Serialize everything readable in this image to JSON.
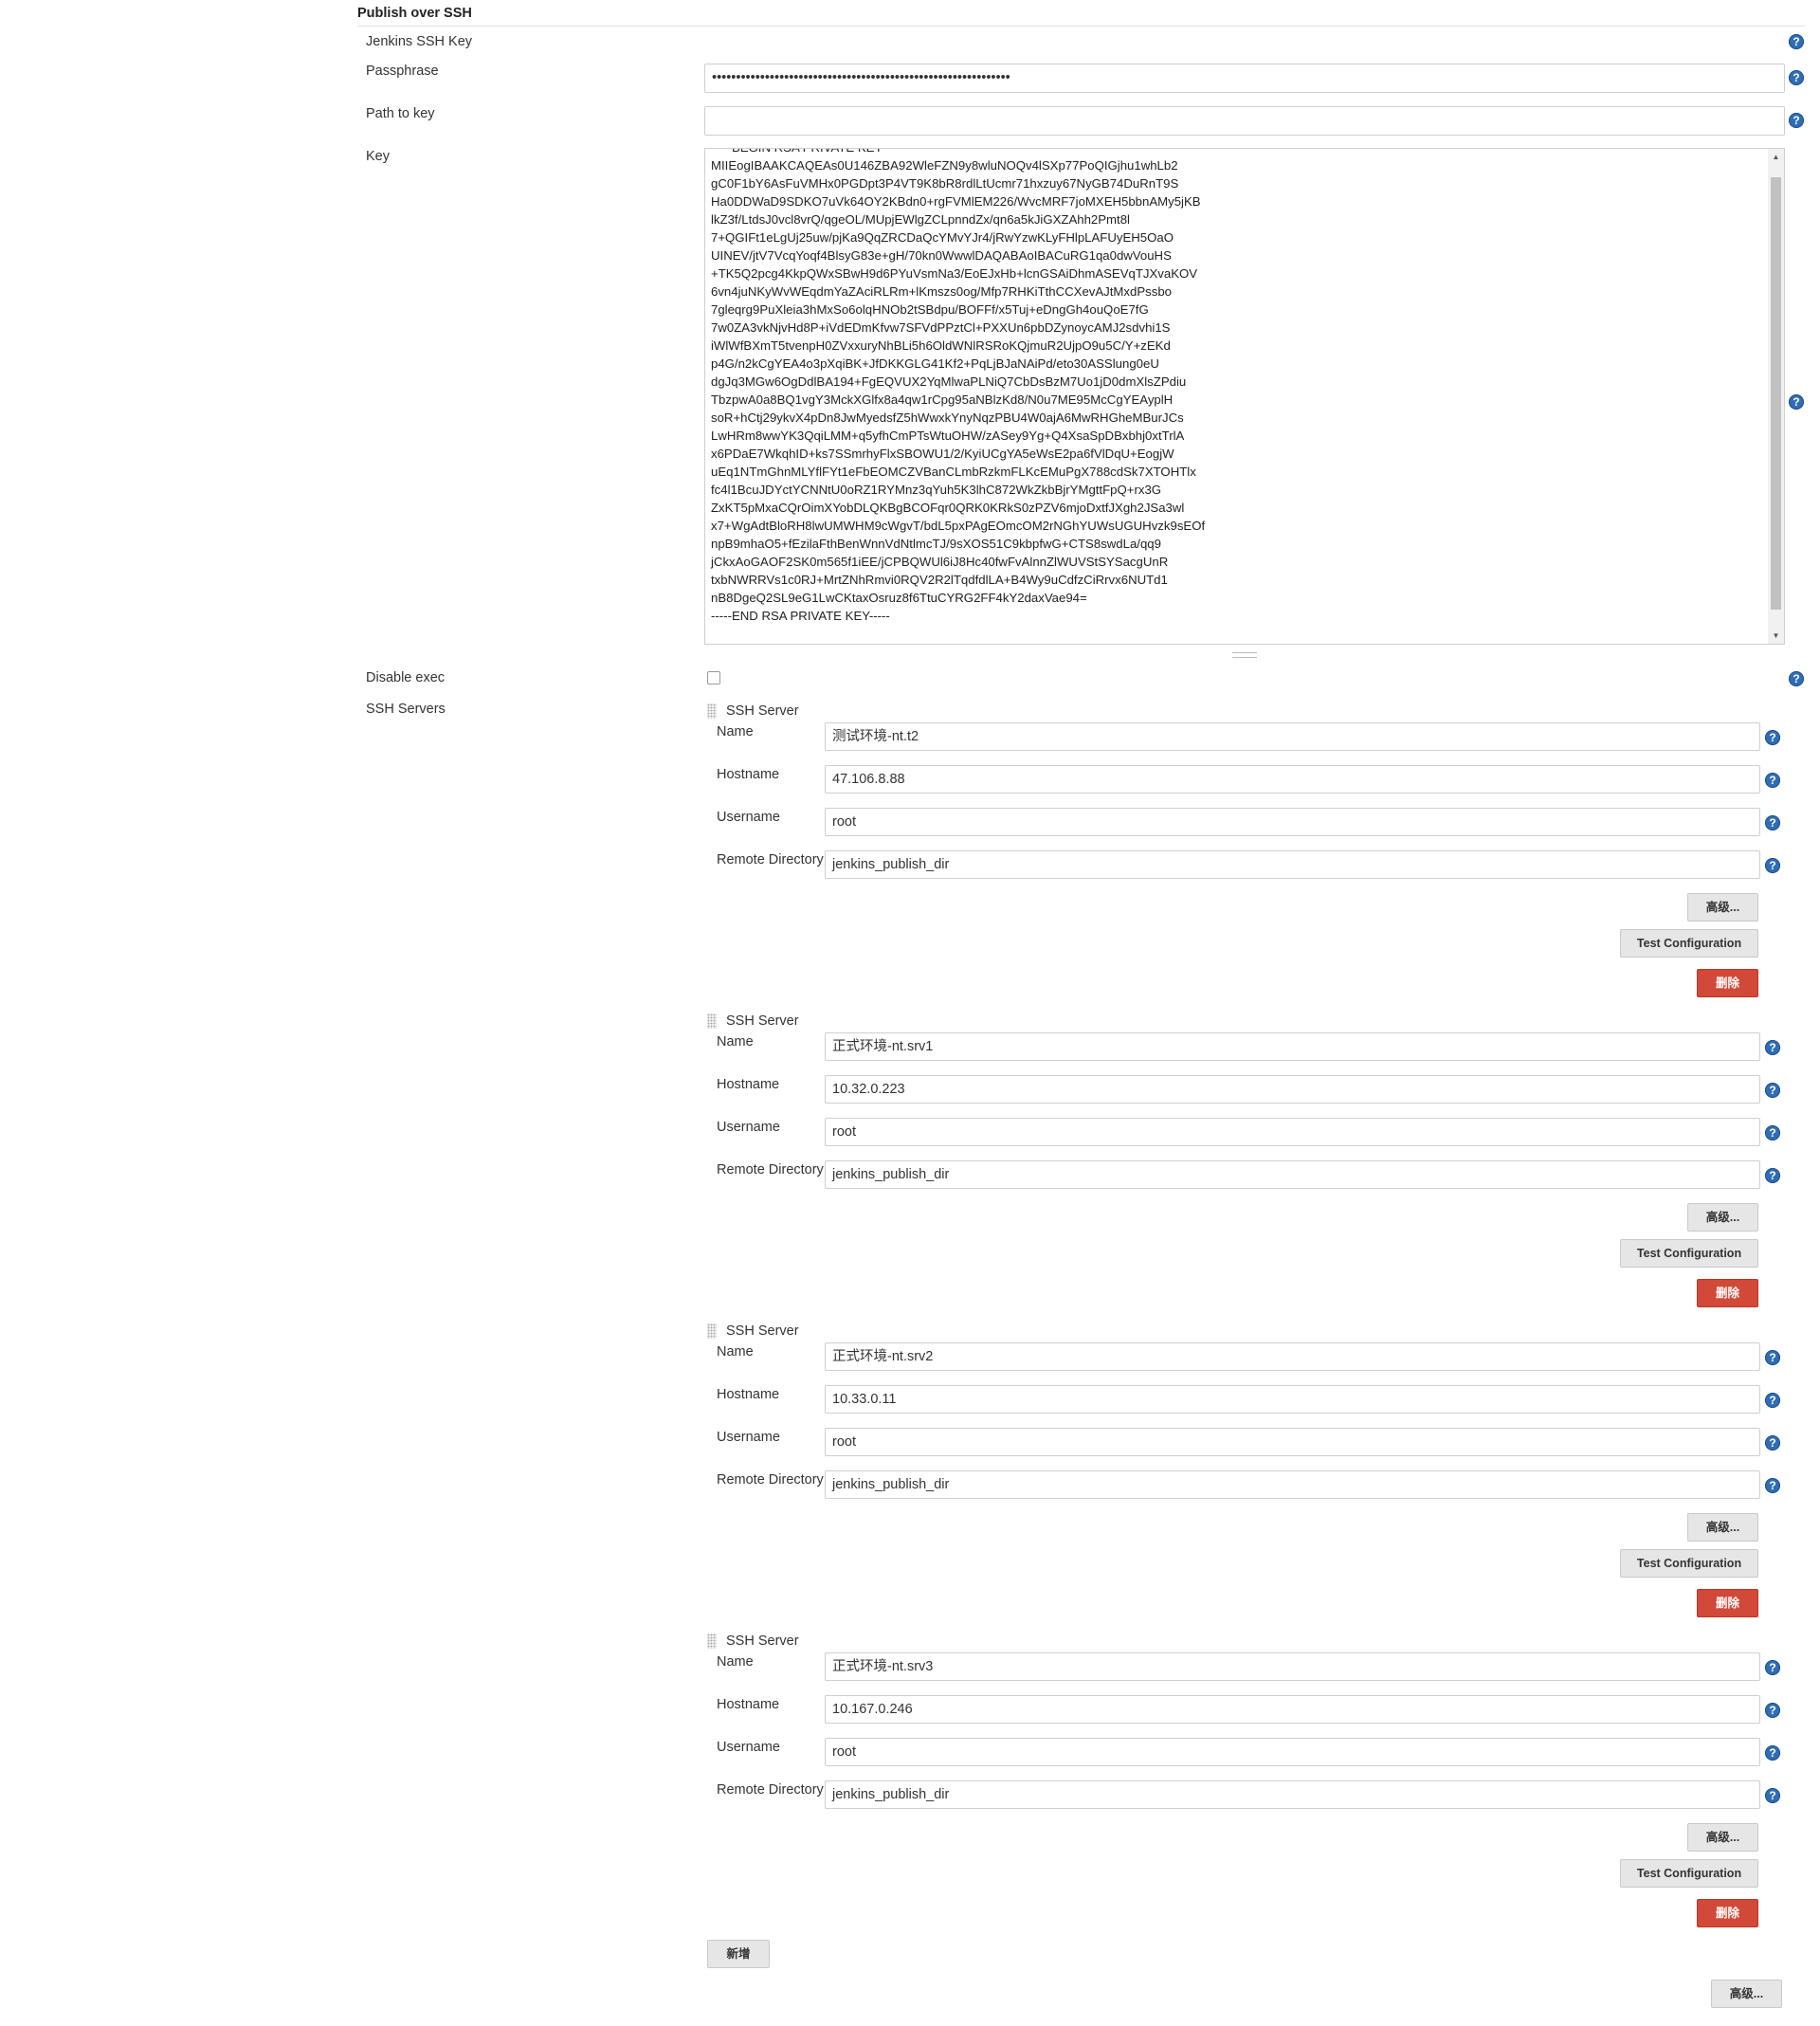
{
  "section_title": "Publish over SSH",
  "fields": {
    "jenkins_ssh_key_label": "Jenkins SSH Key",
    "passphrase_label": "Passphrase",
    "passphrase_value": "••••••••••••••••••••••••••••••••••••••••••••••••••••••••••••••",
    "path_to_key_label": "Path to key",
    "path_to_key_value": "",
    "key_label": "Key",
    "key_value": "-----BEGIN RSA PRIVATE KEY-----\nMIIEogIBAAKCAQEAs0U146ZBA92WleFZN9y8wluNOQv4lSXp77PoQIGjhu1whLb2\ngC0F1bY6AsFuVMHx0PGDpt3P4VT9K8bR8rdlLtUcmr71hxzuy67NyGB74DuRnT9S\nHa0DDWaD9SDKO7uVk64OY2KBdn0+rgFVMlEM226/WvcMRF7joMXEH5bbnAMy5jKB\nlkZ3f/LtdsJ0vcl8vrQ/qgeOL/MUpjEWlgZCLpnndZx/qn6a5kJiGXZAhh2Pmt8l\n7+QGIFt1eLgUj25uw/pjKa9QqZRCDaQcYMvYJr4/jRwYzwKLyFHlpLAFUyEH5OaO\nUINEV/jtV7VcqYoqf4BlsyG83e+gH/70kn0WwwlDAQABAoIBACuRG1qa0dwVouHS\n+TK5Q2pcg4KkpQWxSBwH9d6PYuVsmNa3/EoEJxHb+lcnGSAiDhmASEVqTJXvaKOV\n6vn4juNKyWvWEqdmYaZAciRLRm+lKmszs0og/Mfp7RHKiTthCCXevAJtMxdPssbo\n7gleqrg9PuXleia3hMxSo6olqHNOb2tSBdpu/BOFFf/x5Tuj+eDngGh4ouQoE7fG\n7w0ZA3vkNjvHd8P+iVdEDmKfvw7SFVdPPztCl+PXXUn6pbDZynoycAMJ2sdvhi1S\niWlWfBXmT5tvenpH0ZVxxuryNhBLi5h6OldWNlRSRoKQjmuR2UjpO9u5C/Y+zEKd\np4G/n2kCgYEA4o3pXqiBK+JfDKKGLG41Kf2+PqLjBJaNAiPd/eto30ASSlung0eU\ndgJq3MGw6OgDdlBA194+FgEQVUX2YqMlwaPLNiQ7CbDsBzM7Uo1jD0dmXlsZPdiu\nTbzpwA0a8BQ1vgY3MckXGlfx8a4qw1rCpg95aNBlzKd8/N0u7ME95McCgYEAyplH\nsoR+hCtj29ykvX4pDn8JwMyedsfZ5hWwxkYnyNqzPBU4W0ajA6MwRHGheMBurJCs\nLwHRm8wwYK3QqiLMM+q5yfhCmPTsWtuOHW/zASey9Yg+Q4XsaSpDBxbhj0xtTrlA\nx6PDaE7WkqhID+ks7SSmrhyFlxSBOWU1/2/KyiUCgYA5eWsE2pa6fVlDqU+EogjW\nuEq1NTmGhnMLYflFYt1eFbEOMCZVBanCLmbRzkmFLKcEMuPgX788cdSk7XTOHTlx\nfc4l1BcuJDYctYCNNtU0oRZ1RYMnz3qYuh5K3lhC872WkZkbBjrYMgttFpQ+rx3G\nZxKT5pMxaCQrOimXYobDLQKBgBCOFqr0QRK0KRkS0zPZV6mjoDxtfJXgh2JSa3wl\nx7+WgAdtBloRH8lwUMWHM9cWgvT/bdL5pxPAgEOmcOM2rNGhYUWsUGUHvzk9sEOf\nnpB9mhaO5+fEzilaFthBenWnnVdNtlmcTJ/9sXOS51C9kbpfwG+CTS8swdLa/qq9\njCkxAoGAOF2SK0m565f1iEE/jCPBQWUl6iJ8Hc40fwFvAlnnZlWUVStSYSacgUnR\ntxbNWRRVs1c0RJ+MrtZNhRmvi0RQV2R2lTqdfdlLA+B4Wy9uCdfzCiRrvx6NUTd1\nnB8DgeQ2SL9eG1LwCKtaxOsruz8f6TtuCYRG2FF4kY2daxVae94=\n-----END RSA PRIVATE KEY-----",
    "disable_exec_label": "Disable exec",
    "ssh_servers_label": "SSH Servers"
  },
  "server_labels": {
    "block_title": "SSH Server",
    "name": "Name",
    "hostname": "Hostname",
    "username": "Username",
    "remote_directory": "Remote Directory",
    "advanced_button": "高级...",
    "test_button": "Test Configuration",
    "delete_button": "删除"
  },
  "servers": [
    {
      "name": "测试环境-nt.t2",
      "hostname": "47.106.8.88",
      "username": "root",
      "remote_directory": "jenkins_publish_dir"
    },
    {
      "name": "正式环境-nt.srv1",
      "hostname": "10.32.0.223",
      "username": "root",
      "remote_directory": "jenkins_publish_dir"
    },
    {
      "name": "正式环境-nt.srv2",
      "hostname": "10.33.0.11",
      "username": "root",
      "remote_directory": "jenkins_publish_dir"
    },
    {
      "name": "正式环境-nt.srv3",
      "hostname": "10.167.0.246",
      "username": "root",
      "remote_directory": "jenkins_publish_dir"
    }
  ],
  "add_button": "新增",
  "bottom_advanced_button": "高级...",
  "help_glyph": "?",
  "icons": {
    "help": "question-circle-icon",
    "drag": "drag-handle-icon"
  },
  "colors": {
    "help": "#2f6db5",
    "delete": "#d24939",
    "button_bg": "#e6e6e6"
  }
}
